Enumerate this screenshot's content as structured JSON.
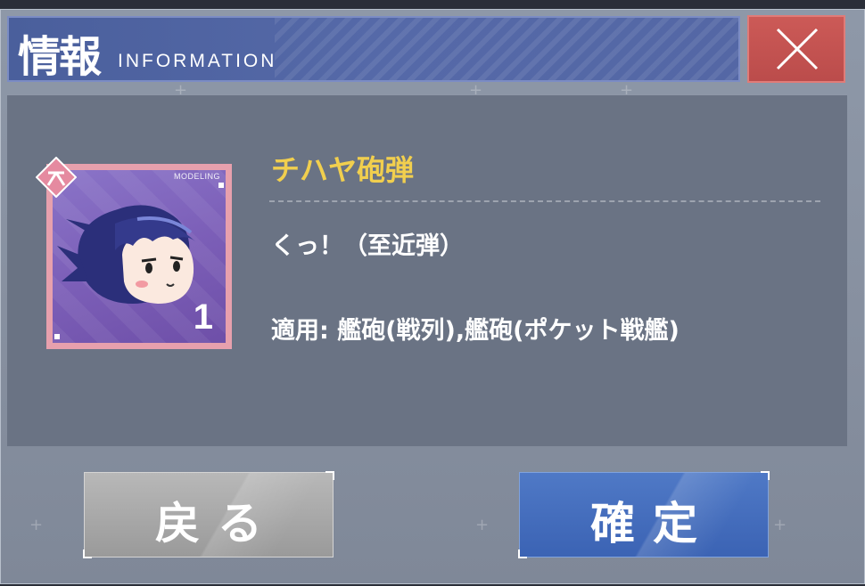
{
  "header": {
    "title_jp": "情報",
    "title_en": "INFORMATION"
  },
  "close_icon": "close-icon",
  "item": {
    "badge_label": "MODELING",
    "count": "1",
    "name": "チハヤ砲弾",
    "description": "くっ！（至近弾）",
    "applicable": "適用: 艦砲(戦列),艦砲(ポケット戦艦)"
  },
  "buttons": {
    "back_label": "戻る",
    "confirm_label": "確定"
  },
  "colors": {
    "header_bg": "#5467a5",
    "close_bg": "#c4534f",
    "panel_bg": "#6a7384",
    "item_name": "#f1cf4e",
    "card_frame": "#e7a0ad",
    "card_bg": "#7c5fb8",
    "confirm_bg": "#4a6fbf",
    "back_bg": "#a8a8a8"
  }
}
